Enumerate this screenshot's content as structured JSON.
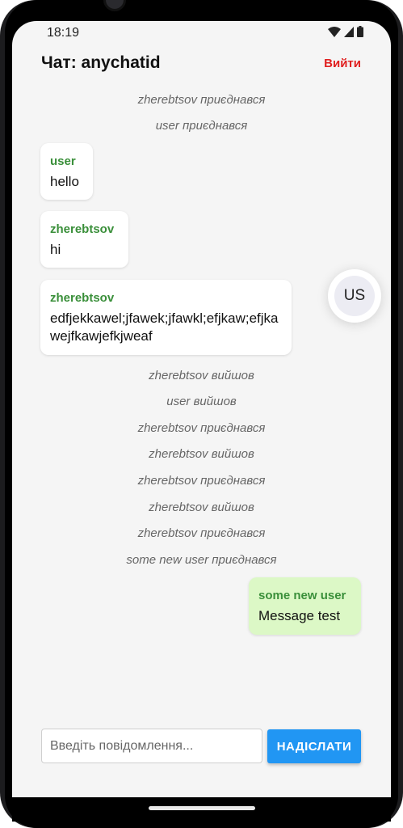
{
  "status_bar": {
    "time": "18:19"
  },
  "header": {
    "title": "Чат: anychatid",
    "exit_label": "Вийти"
  },
  "messages": {
    "sys1": "zherebtsov приєднався",
    "sys2": "user приєднався",
    "m1": {
      "sender": "user",
      "text": "hello"
    },
    "m2": {
      "sender": "zherebtsov",
      "text": "hi"
    },
    "m3": {
      "sender": "zherebtsov",
      "text": "edfjekkawel;jfawek;jfawkl;efjkaw;efjkawejfkawjefkjweaf"
    },
    "sys3": "zherebtsov вийшов",
    "sys4": "user вийшов",
    "sys5": "zherebtsov приєднався",
    "sys6": "zherebtsov вийшов",
    "sys7": "zherebtsov приєднався",
    "sys8": "zherebtsov вийшов",
    "sys9": "zherebtsov приєднався",
    "sys10": "some new user приєднався",
    "m4": {
      "sender": "some new user",
      "text": "Message test"
    }
  },
  "avatar": {
    "initials": "US"
  },
  "composer": {
    "placeholder": "Введіть повідомлення...",
    "send_label": "НАДІСЛАТИ"
  },
  "colors": {
    "accent": "#2196f3",
    "exit": "#e02020",
    "sender": "#3a8f3a",
    "own_bubble": "#dcf8c6"
  }
}
